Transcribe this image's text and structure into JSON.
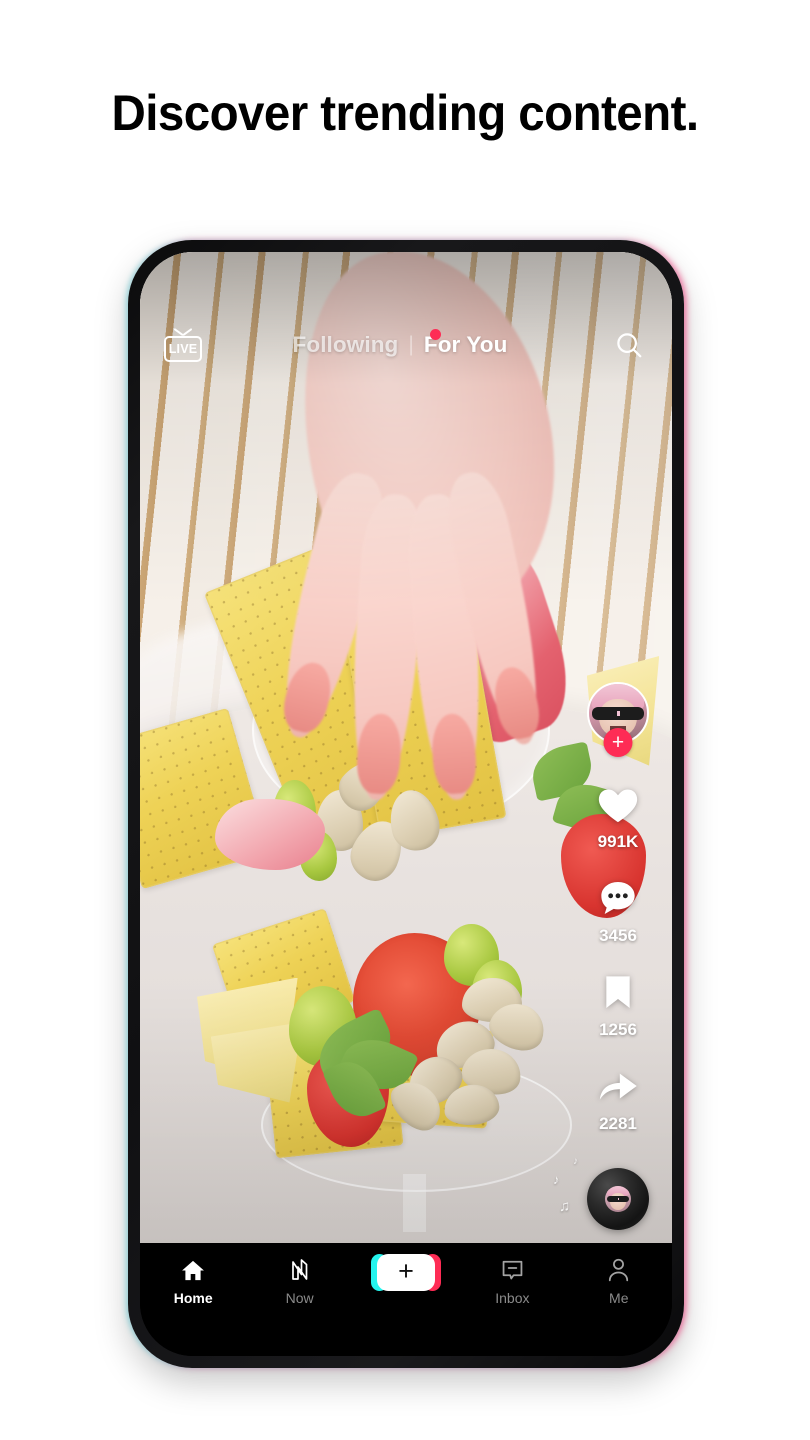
{
  "headline": "Discover trending content.",
  "phone": {
    "top_nav": {
      "live_label": "LIVE",
      "live_icon": "live-tv-icon",
      "tabs": [
        {
          "label": "Following",
          "active": false,
          "badge_dot": true
        },
        {
          "label": "For You",
          "active": true,
          "badge_dot": false
        }
      ],
      "separator": "|",
      "search_icon": "search-icon"
    },
    "video": {
      "description": "Hand reaching for charcuterie cups with crackers, salami, olives, strawberry and pistachios"
    },
    "action_rail": {
      "avatar_name": "creator-avatar",
      "follow_label": "+",
      "actions": [
        {
          "icon": "heart-icon",
          "name": "like",
          "count": "991K"
        },
        {
          "icon": "comment-icon",
          "name": "comment",
          "count": "3456"
        },
        {
          "icon": "bookmark-icon",
          "name": "bookmark",
          "count": "1256"
        },
        {
          "icon": "share-icon",
          "name": "share",
          "count": "2281"
        }
      ],
      "music_disc": "music-disc"
    },
    "tabbar": [
      {
        "label": "Home",
        "icon": "home-icon",
        "active": true
      },
      {
        "label": "Now",
        "icon": "now-icon",
        "active": false
      },
      {
        "label": "",
        "icon": "create-plus-icon",
        "active": false
      },
      {
        "label": "Inbox",
        "icon": "inbox-icon",
        "active": false
      },
      {
        "label": "Me",
        "icon": "profile-icon",
        "active": false
      }
    ],
    "create_plus": "+"
  },
  "colors": {
    "accent_pink": "#fe2c55",
    "accent_cyan": "#25f4ee",
    "background": "#ffffff",
    "tabbar_bg": "#000000"
  }
}
